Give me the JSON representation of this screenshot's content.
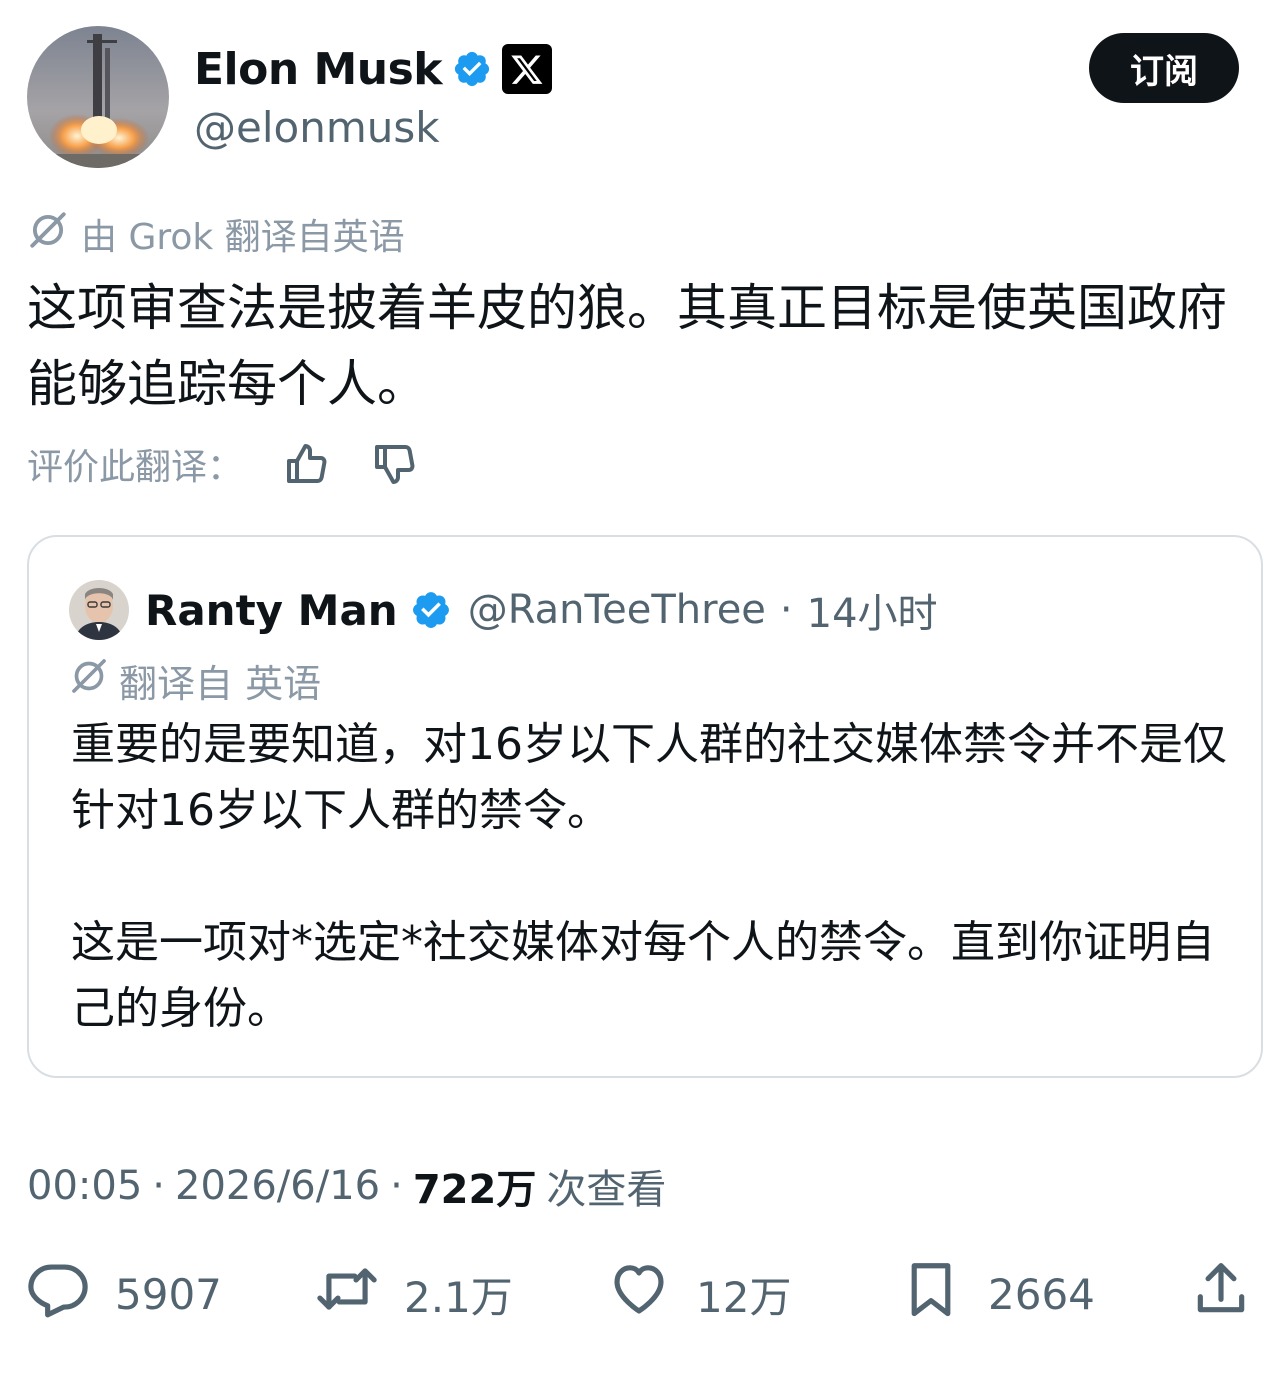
{
  "author": {
    "display_name": "Elon Musk",
    "handle": "@elonmusk",
    "verified_icon": "verified-badge-icon",
    "affiliate_icon": "x-logo-icon"
  },
  "header": {
    "subscribe_label": "订阅"
  },
  "translation": {
    "note": "由 Grok 翻译自英语",
    "text": "这项审查法是披着羊皮的狼。其真正目标是使英国政府能够追踪每个人。",
    "rate_label": "评价此翻译："
  },
  "quote": {
    "display_name": "Ranty Man",
    "handle": "@RanTeeThree",
    "separator": "·",
    "time": "14小时",
    "translate_note": "翻译自 英语",
    "paragraphs": [
      "重要的是要知道，对16岁以下人群的社交媒体禁令并不是仅针对16岁以下人群的禁令。",
      "这是一项对*选定*社交媒体对每个人的禁令。直到你证明自己的身份。"
    ]
  },
  "meta": {
    "time": "00:05",
    "separator": "·",
    "date": "2026/6/16",
    "views_count": "722万",
    "views_label": "次查看"
  },
  "actions": {
    "replies": "5907",
    "reposts": "2.1万",
    "likes": "12万",
    "bookmarks": "2664"
  },
  "colors": {
    "text": "#0f1419",
    "secondary": "#536471",
    "muted": "#8b98a5",
    "verified": "#1d9bf0",
    "border": "#d9dee3"
  }
}
